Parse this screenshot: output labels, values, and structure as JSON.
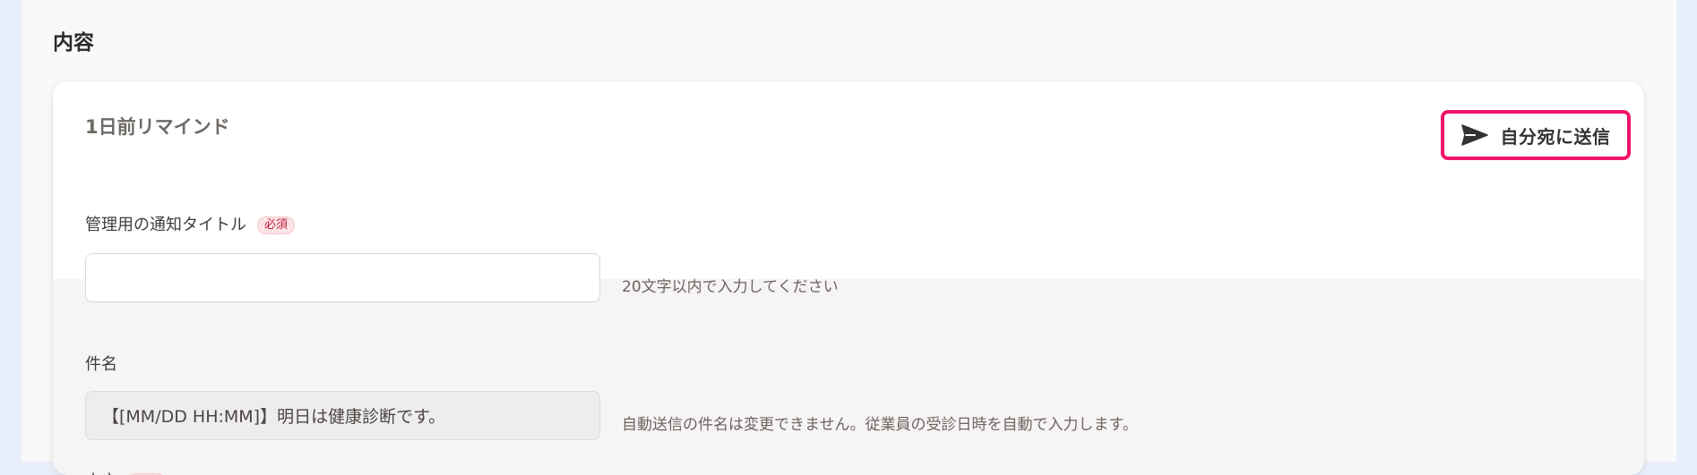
{
  "section": {
    "title": "内容"
  },
  "card": {
    "title": "1日前リマインド",
    "send_button_label": "自分宛に送信",
    "send_icon": "paper-plane-icon"
  },
  "fields": {
    "notification_title": {
      "label": "管理用の通知タイトル",
      "required_badge": "必須",
      "value": "",
      "hint": "20文字以内で入力してください"
    },
    "subject": {
      "label": "件名",
      "value": "【[MM/DD HH:MM]】明日は健康診断です。",
      "hint": "自動送信の件名は変更できません。従業員の受診日時を自動で入力します。"
    },
    "body": {
      "label": "本文",
      "required_badge": "必須"
    }
  },
  "colors": {
    "accent_border": "#f0146a",
    "required_text": "#c21d3a",
    "required_bg": "#fbe3e6"
  }
}
